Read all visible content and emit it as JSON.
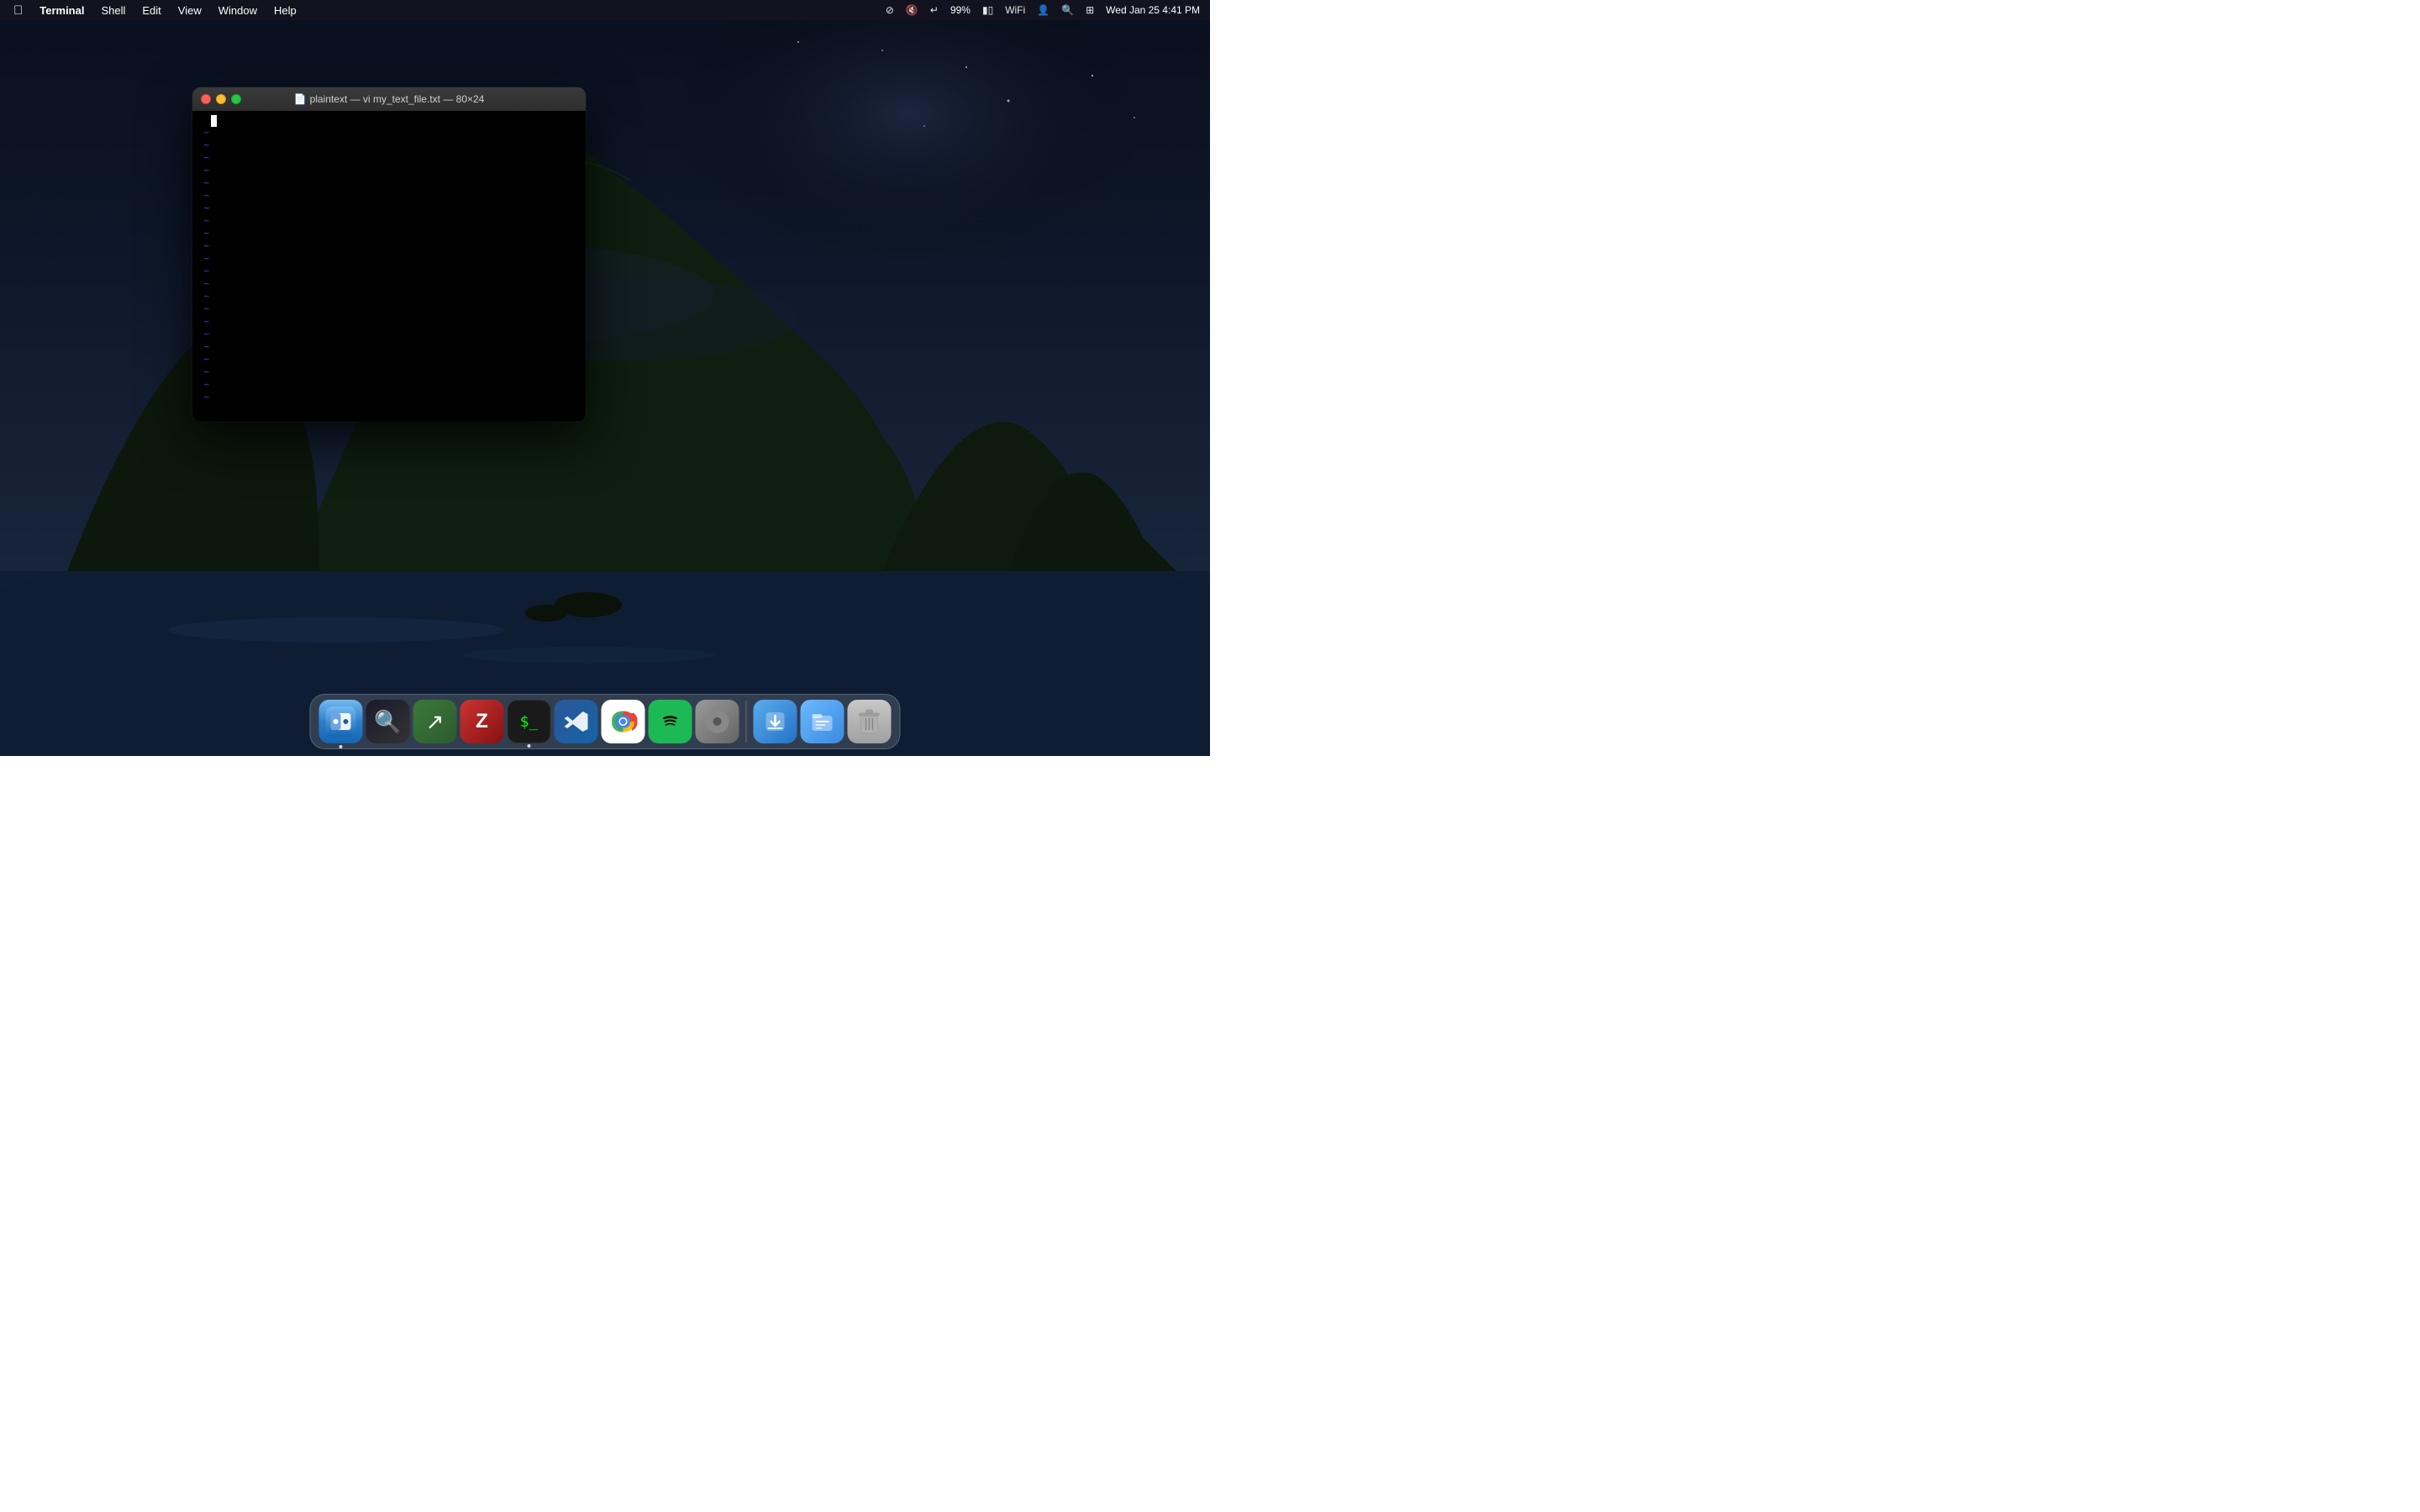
{
  "desktop": {
    "background_description": "macOS Catalina dark island night scene"
  },
  "menubar": {
    "apple_label": "",
    "app_name": "Terminal",
    "items": [
      {
        "label": "Shell",
        "id": "shell"
      },
      {
        "label": "Edit",
        "id": "edit"
      },
      {
        "label": "View",
        "id": "view"
      },
      {
        "label": "Window",
        "id": "window"
      },
      {
        "label": "Help",
        "id": "help"
      }
    ],
    "status": {
      "datetime": "Wed Jan 25  4:41 PM",
      "battery": "99%"
    }
  },
  "terminal_window": {
    "title": "plaintext — vi my_text_file.txt — 80×24",
    "title_icon": "📄",
    "dimensions": "80×24",
    "filename": "my_text_file.txt",
    "app": "plaintext",
    "editor": "vi"
  },
  "dock": {
    "items": [
      {
        "name": "Finder",
        "icon": "finder",
        "has_indicator": true
      },
      {
        "name": "ProxyMan",
        "icon": "proxy",
        "has_indicator": false
      },
      {
        "name": "Migration Assistant",
        "icon": "migrate",
        "has_indicator": false
      },
      {
        "name": "Zotero",
        "icon": "zotero",
        "has_indicator": false
      },
      {
        "name": "Terminal",
        "icon": "terminal",
        "has_indicator": true
      },
      {
        "name": "Visual Studio Code",
        "icon": "vscode",
        "has_indicator": false
      },
      {
        "name": "Google Chrome",
        "icon": "chrome",
        "has_indicator": false
      },
      {
        "name": "Spotify",
        "icon": "spotify",
        "has_indicator": false
      },
      {
        "name": "System Preferences",
        "icon": "sysprefs",
        "has_indicator": false
      },
      {
        "name": "Downloads",
        "icon": "downloads",
        "has_indicator": false
      },
      {
        "name": "File Browser",
        "icon": "filebrowser",
        "has_indicator": false
      },
      {
        "name": "Trash",
        "icon": "trash",
        "has_indicator": false
      }
    ]
  }
}
